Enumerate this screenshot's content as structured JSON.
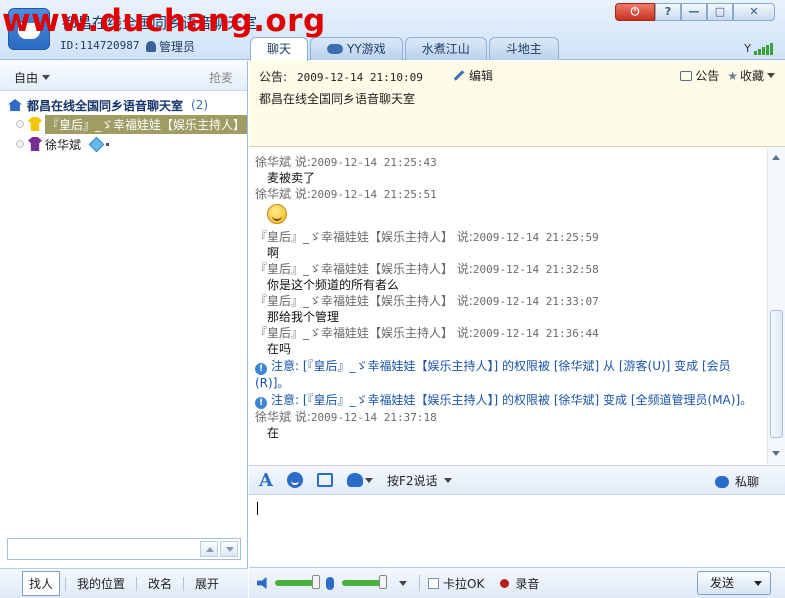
{
  "watermark": "www.duchang.org",
  "header": {
    "channel_title": "都昌在线全国同乡语音聊天室",
    "id_text": "ID:114720987",
    "role": "管理员",
    "tabs": [
      {
        "label": "聊天",
        "active": true
      },
      {
        "label": "YY游戏",
        "active": false
      },
      {
        "label": "水煮江山",
        "active": false
      },
      {
        "label": "斗地主",
        "active": false
      }
    ],
    "window_buttons": {
      "help": "?",
      "minimize": "—",
      "maximize": "□",
      "close": "✕"
    }
  },
  "left_panel": {
    "mode": "自由",
    "grab_mic": "抢麦",
    "channel_name": "都昌在线全国同乡语音聊天室",
    "member_count": "(2)",
    "members": [
      {
        "name": "『皇后』_ゞ幸福娃娃【娱乐主持人】",
        "selected": true
      },
      {
        "name": "徐华斌",
        "selected": false
      }
    ],
    "footer_buttons": [
      "找人",
      "我的位置",
      "改名",
      "展开"
    ]
  },
  "announcement": {
    "label": "公告:",
    "timestamp": "2009-12-14 21:10:09",
    "edit": "编辑",
    "text": "都昌在线全国同乡语音聊天室",
    "notice_btn": "公告",
    "favorite_btn": "收藏"
  },
  "chat": {
    "messages": [
      {
        "author": "徐华斌",
        "said": "说:",
        "time": "2009-12-14 21:25:43",
        "text": "麦被卖了"
      },
      {
        "author": "徐华斌",
        "said": "说:",
        "time": "2009-12-14 21:25:51",
        "emoji": "grin"
      },
      {
        "author": "『皇后』_ゞ幸福娃娃【娱乐主持人】",
        "said": "说:",
        "time": "2009-12-14 21:25:59",
        "text": "啊"
      },
      {
        "author": "『皇后』_ゞ幸福娃娃【娱乐主持人】",
        "said": "说:",
        "time": "2009-12-14 21:32:58",
        "text": "你是这个频道的所有者么"
      },
      {
        "author": "『皇后』_ゞ幸福娃娃【娱乐主持人】",
        "said": "说:",
        "time": "2009-12-14 21:33:07",
        "text": "那给我个管理"
      },
      {
        "author": "『皇后』_ゞ幸福娃娃【娱乐主持人】",
        "said": "说:",
        "time": "2009-12-14 21:36:44",
        "text": "在吗"
      }
    ],
    "notices": [
      "注意: [『皇后』_ゞ幸福娃娃【娱乐主持人】] 的权限被 [徐华斌] 从 [游客(U)] 变成 [会员(R)]。",
      "注意: [『皇后』_ゞ幸福娃娃【娱乐主持人】] 的权限被 [徐华斌] 变成 [全频道管理员(MA)]。"
    ],
    "last_message": {
      "author": "徐华斌",
      "said": "说:",
      "time": "2009-12-14 21:37:18",
      "text": "在"
    }
  },
  "toolbar": {
    "font_glyph": "A",
    "talk_mode": "按F2说话",
    "private_chat": "私聊"
  },
  "bottom_bar": {
    "volume_level": 0.85,
    "mic_level": 0.85,
    "karaoke": "卡拉OK",
    "record": "录音",
    "send": "发送"
  }
}
